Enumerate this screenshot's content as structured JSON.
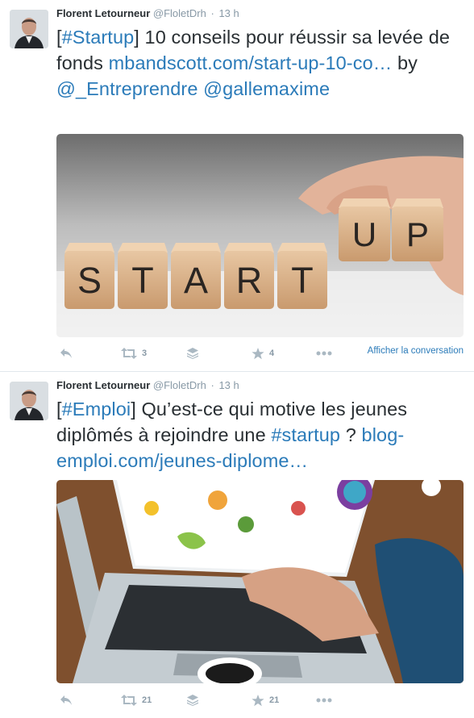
{
  "tweets": [
    {
      "author": {
        "fullname": "Florent Letourneur",
        "username": "@FloletDrh"
      },
      "time": "13 h",
      "text": [
        {
          "t": "[",
          "link": false
        },
        {
          "t": "#Startup",
          "link": true
        },
        {
          "t": "] 10 conseils pour réussir sa levée de fonds  ",
          "link": false
        },
        {
          "t": "mbandscott.com/start-up-10-co…",
          "link": true
        },
        {
          "t": "  by ",
          "link": false
        },
        {
          "t": "@_Entreprendre",
          "link": true
        },
        {
          "t": " ",
          "link": false
        },
        {
          "t": "@gallemaxime",
          "link": true
        }
      ],
      "image": {
        "word_bottom": [
          "S",
          "T",
          "A",
          "R",
          "T"
        ],
        "word_top": [
          "U",
          "P"
        ],
        "icon": "start-up-dice-photo"
      },
      "actions": {
        "reply_icon": "reply-icon",
        "retweet_count": "3",
        "fav_count": "4",
        "more_icon": "more-icon"
      },
      "conversation_link": "Afficher la conversation"
    },
    {
      "author": {
        "fullname": "Florent Letourneur",
        "username": "@FloletDrh"
      },
      "time": "13 h",
      "text": [
        {
          "t": "[",
          "link": false
        },
        {
          "t": "#Emploi",
          "link": true
        },
        {
          "t": "] Qu’est-ce qui motive les jeunes diplômés à rejoindre une ",
          "link": false
        },
        {
          "t": "#startup",
          "link": true
        },
        {
          "t": " ? ",
          "link": false
        },
        {
          "t": "blog-emploi.com/jeunes-diplome…",
          "link": true
        }
      ],
      "image": {
        "icon": "laptop-startup-photo"
      },
      "actions": {
        "reply_icon": "reply-icon",
        "retweet_count": "21",
        "fav_count": "21",
        "more_icon": "more-icon"
      }
    }
  ],
  "colors": {
    "link": "#2b7bb9",
    "meta": "#8899a6",
    "text": "#292f33"
  }
}
